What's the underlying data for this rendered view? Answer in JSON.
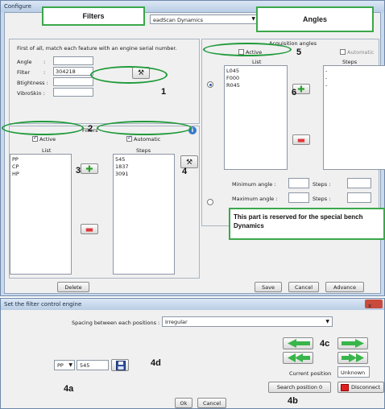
{
  "window1": {
    "title": "Configure",
    "combo_value": "eadScan Dynamics",
    "intro_text": "First of all, match each feature with an engine serial number.",
    "fields": [
      {
        "label": "Angle",
        "sep": ":",
        "value": ""
      },
      {
        "label": "Filter",
        "sep": ":",
        "value": "304218"
      },
      {
        "label": "Btightness :",
        "sep": "",
        "value": ""
      },
      {
        "label": "VibroSkin :",
        "sep": "",
        "value": ""
      }
    ],
    "filters": {
      "title": "Filters",
      "active_label": "Active",
      "automatic_label": "Automatic",
      "list_header": "List",
      "steps_header": "Steps",
      "list_items": [
        "PP",
        "CP",
        "HP"
      ],
      "steps_items": [
        "545",
        "1837",
        "3091"
      ]
    },
    "angles": {
      "title": "Acquisition angles",
      "active_label": "Active",
      "automatic_label": "Automatic",
      "list_header": "List",
      "steps_header": "Steps",
      "list_items": [
        "L045",
        "F000",
        "R045"
      ],
      "steps_items": [
        "-",
        "-",
        "-"
      ],
      "min_angle_label": "Minimum angle :",
      "max_angle_label": "Maximum angle :",
      "steps_label_1": "Steps :",
      "steps_label_2": "Steps :",
      "reserved_note": "This part is reserved for the special bench Dynamics"
    },
    "buttons": {
      "delete": "Delete",
      "save": "Save",
      "cancel": "Cancel",
      "advance": "Advance"
    }
  },
  "callouts": {
    "filters": "Filters",
    "angles": "Angles",
    "n1": "1",
    "n2": "2",
    "n3": "3",
    "n4": "4",
    "n5": "5",
    "n6": "6",
    "n4a": "4a",
    "n4b": "4b",
    "n4c": "4c",
    "n4d": "4d"
  },
  "window2": {
    "title": "Set the filter control engine",
    "close_glyph": "x",
    "spacing_label": "Spacing between each positions :",
    "spacing_value": "Irregular",
    "filter_select": "PP",
    "steps_value": "545",
    "current_position_label": "Current position",
    "current_position_value": "Unknown",
    "search_button": "Search position 0",
    "disconnect_button": "Disconnect",
    "ok_button": "Ok",
    "cancel_button": "Cancel"
  }
}
